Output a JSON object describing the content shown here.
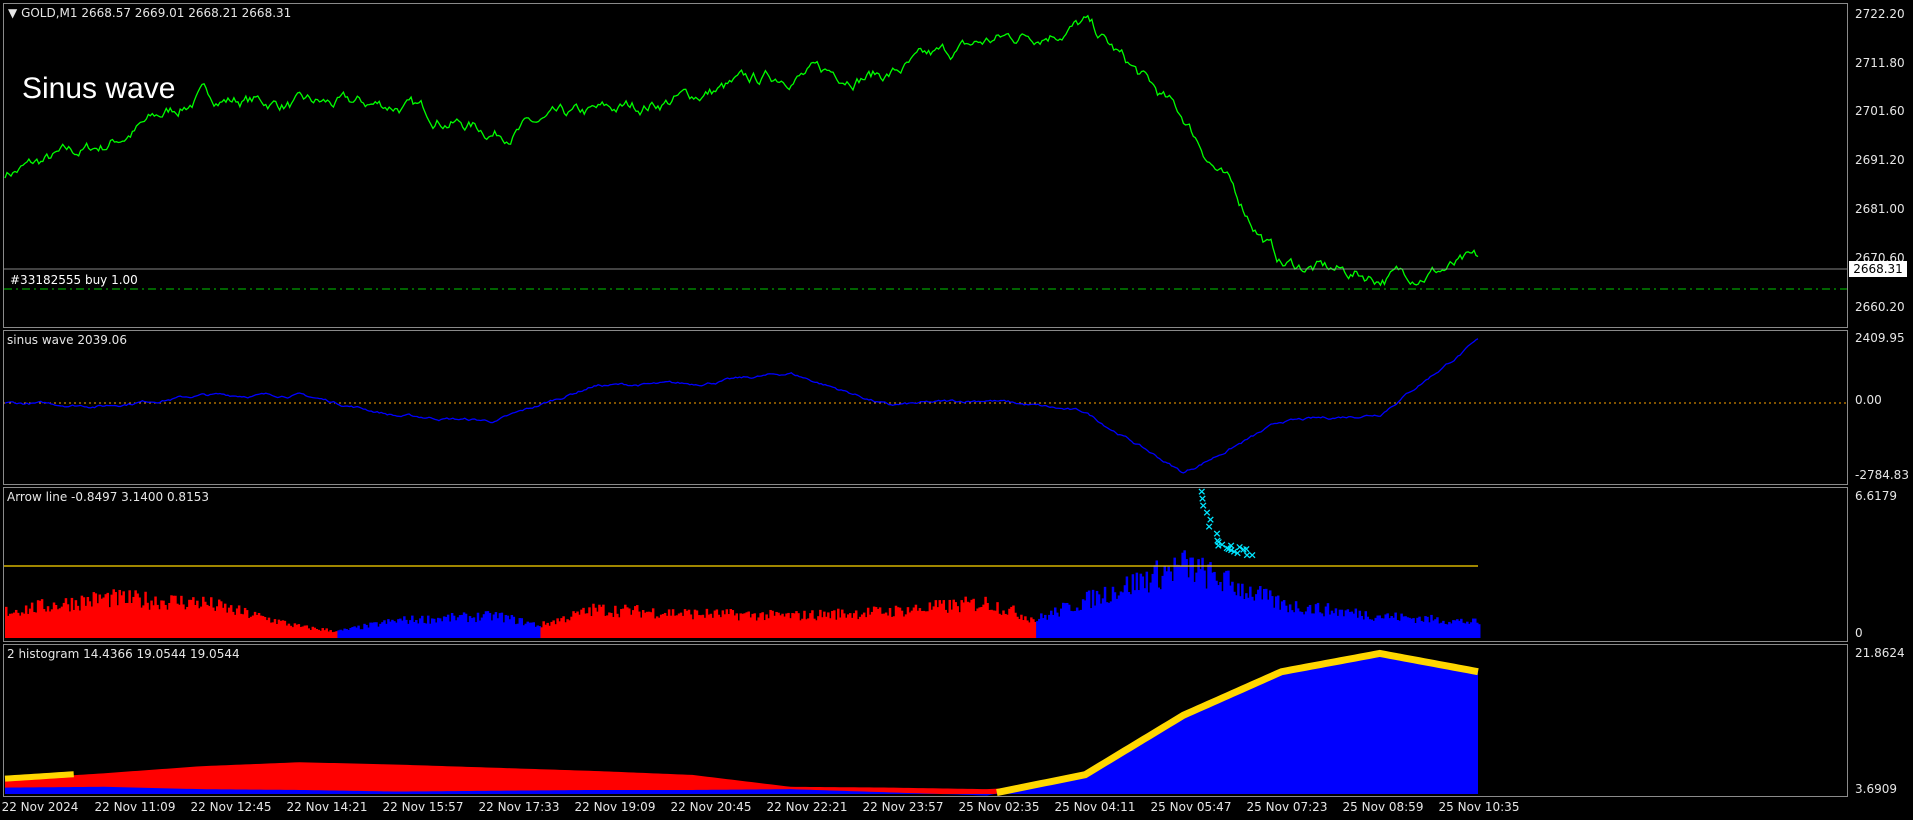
{
  "main": {
    "symbol_header": "GOLD,M1  2668.57 2669.01 2668.21 2668.31",
    "overlay_text": "Sinus wave",
    "trade_line_label": "#33182555 buy 1.00",
    "current_price": "2668.31",
    "price_axis": [
      "2722.20",
      "2711.80",
      "2701.60",
      "2691.20",
      "2681.00",
      "2670.60",
      "2660.20"
    ]
  },
  "sinus": {
    "label": "sinus wave 2039.06",
    "axis": [
      "2409.95",
      "0.00",
      "-2784.83"
    ]
  },
  "arrow": {
    "label": "Arrow line -0.8497 3.1400 0.8153",
    "axis": [
      "6.6179",
      "0"
    ]
  },
  "histogram": {
    "label": "2 histogram 14.4366 19.0544 19.0544",
    "axis": [
      "21.8624",
      "3.6909"
    ]
  },
  "time_axis": [
    "22 Nov 2024",
    "22 Nov 11:09",
    "22 Nov 12:45",
    "22 Nov 14:21",
    "22 Nov 15:57",
    "22 Nov 17:33",
    "22 Nov 19:09",
    "22 Nov 20:45",
    "22 Nov 22:21",
    "22 Nov 23:57",
    "25 Nov 02:35",
    "25 Nov 04:11",
    "25 Nov 05:47",
    "25 Nov 07:23",
    "25 Nov 08:59",
    "25 Nov 10:35"
  ],
  "colors": {
    "price_line": "#00ff00",
    "sinus_line": "#0000ff",
    "hist_red": "#ff0000",
    "hist_blue": "#0000ff",
    "arrow_marks": "#00e5ff",
    "level_line": "#ffd700",
    "zero_line": "#ffa500"
  },
  "chart_data": [
    {
      "type": "line",
      "title": "GOLD,M1",
      "x": [
        "22 Nov 2024",
        "22 Nov 11:09",
        "22 Nov 12:45",
        "22 Nov 14:21",
        "22 Nov 15:57",
        "22 Nov 17:33",
        "22 Nov 19:09",
        "22 Nov 20:45",
        "22 Nov 22:21",
        "22 Nov 23:57",
        "25 Nov 02:35",
        "25 Nov 04:11",
        "25 Nov 05:47",
        "25 Nov 07:23",
        "25 Nov 08:59",
        "25 Nov 10:35"
      ],
      "series": [
        {
          "values": [
            2688,
            2694,
            2705,
            2703,
            2703,
            2697,
            2701,
            2705,
            2710,
            2710,
            2717,
            2721,
            2700,
            2668,
            2665,
            2668
          ]
        }
      ],
      "ylim": [
        2656,
        2724
      ]
    },
    {
      "type": "line",
      "title": "sinus wave",
      "series": [
        {
          "values": [
            0,
            -100,
            280,
            300,
            -480,
            -680,
            650,
            700,
            1100,
            -100,
            120,
            -350,
            -2600,
            -700,
            -400,
            2300
          ]
        }
      ],
      "ylim": [
        -2784.83,
        2409.95
      ]
    },
    {
      "type": "area",
      "title": "Arrow line",
      "series": [
        {
          "name": "red",
          "values": [
            1.2,
            1.8,
            1.6,
            0.5,
            0,
            0,
            1.3,
            1.1,
            1.0,
            1.2,
            1.6,
            0,
            0,
            0,
            0,
            0
          ]
        },
        {
          "name": "blue",
          "values": [
            0,
            0,
            0,
            0,
            0.8,
            1.0,
            0,
            0,
            0,
            0,
            0,
            1.7,
            3.3,
            1.5,
            1.0,
            0.7
          ]
        }
      ],
      "ylim": [
        0,
        6.6179
      ]
    },
    {
      "type": "area",
      "title": "2 histogram",
      "series": [
        {
          "name": "blue",
          "values": [
            4.5,
            4.6,
            4.3,
            4.2,
            4.0,
            4.1,
            4.2,
            4.2,
            4.3,
            3.9,
            3.5,
            6.0,
            13.5,
            19.0,
            21.3,
            19.0
          ]
        },
        {
          "name": "red",
          "values": [
            5.5,
            6.3,
            7.2,
            7.7,
            7.4,
            7.0,
            6.6,
            6.1,
            4.6,
            4.5,
            4.3,
            5.0,
            6.2,
            0,
            0,
            0
          ]
        }
      ],
      "ylim": [
        3.6909,
        21.8624
      ]
    }
  ]
}
